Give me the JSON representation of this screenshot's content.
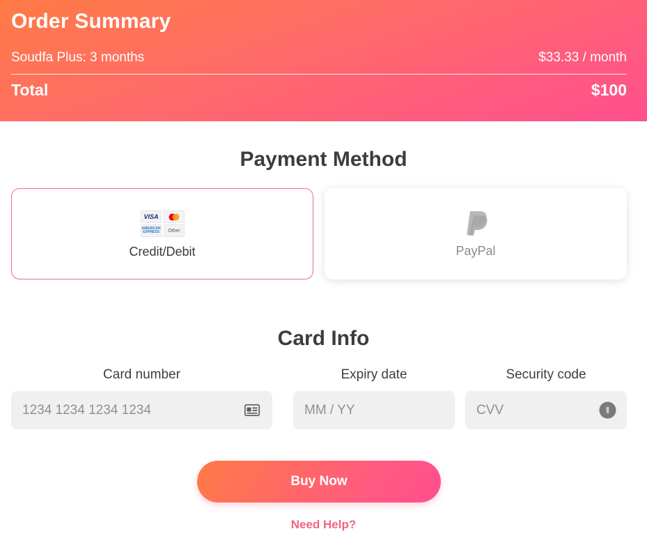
{
  "order_summary": {
    "title": "Order Summary",
    "item_label": "Soudfa Plus: 3 months",
    "item_price": "$33.33 / month",
    "total_label": "Total",
    "total_value": "$100"
  },
  "payment_method": {
    "title": "Payment Method",
    "options": [
      {
        "label": "Credit/Debit",
        "selected": true,
        "icon": "card-brands-icon"
      },
      {
        "label": "PayPal",
        "selected": false,
        "icon": "paypal-icon"
      }
    ],
    "card_logos": {
      "visa": "VISA",
      "amex": "AMERICAN EXPRESS",
      "other": "Other"
    }
  },
  "card_info": {
    "title": "Card Info",
    "card_number": {
      "label": "Card number",
      "placeholder": "1234 1234 1234 1234",
      "icon": "card-icon"
    },
    "expiry": {
      "label": "Expiry date",
      "placeholder": "MM / YY"
    },
    "security": {
      "label": "Security code",
      "placeholder": "CVV",
      "icon": "info-icon"
    }
  },
  "actions": {
    "buy_label": "Buy Now",
    "help_label": "Need Help?"
  },
  "colors": {
    "accent_start": "#ff7b45",
    "accent_end": "#ff4f8f",
    "selected_border": "#f06b86",
    "help_link": "#f0657f"
  }
}
